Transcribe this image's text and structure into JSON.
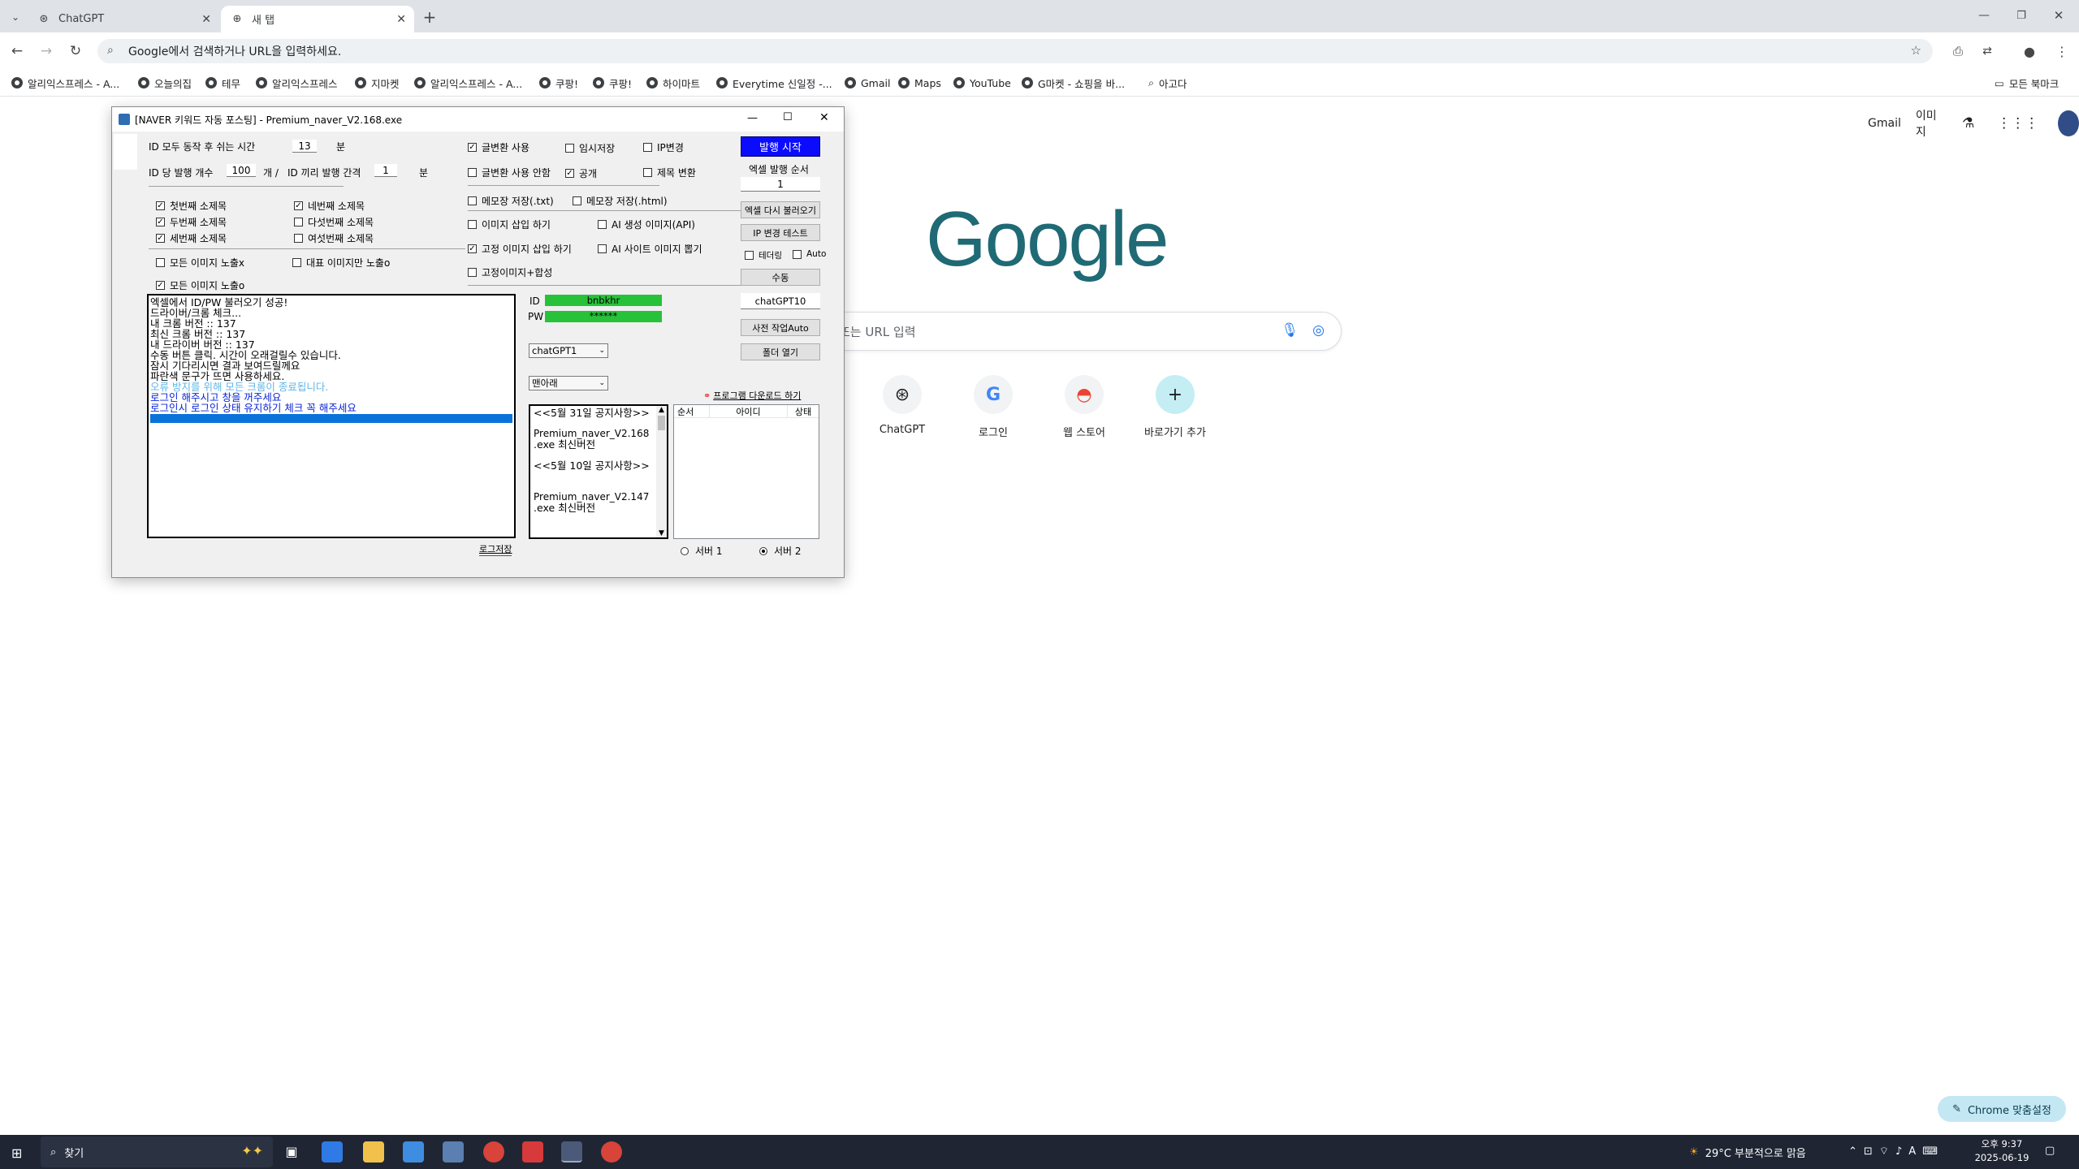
{
  "browser": {
    "tabs": [
      {
        "label": "ChatGPT",
        "active": false
      },
      {
        "label": "새 탭",
        "active": true
      }
    ],
    "omnibox_placeholder": "Google에서 검색하거나 URL을 입력하세요.",
    "bookmarks": [
      "알리익스프레스 - A...",
      "오늘의집",
      "테무",
      "알리익스프레스",
      "지마켓",
      "알리익스프레스 - A...",
      "쿠팡!",
      "쿠팡!",
      "하이마트",
      "Everytime 신일정 -...",
      "Gmail",
      "Maps",
      "YouTube",
      "G마켓 - 쇼핑을 바...",
      "아고다"
    ],
    "all_bookmarks": "모든 북마크"
  },
  "google": {
    "links": [
      "Gmail",
      "이미지"
    ],
    "logo": "Google",
    "search_placeholder": "또는 URL 입력",
    "shortcuts": [
      "ChatGPT",
      "로그인",
      "웹 스토어",
      "바로가기 추가"
    ],
    "customize": "Chrome 맞춤설정"
  },
  "app": {
    "title": "[NAVER 키워드 자동 포스팅] - Premium_naver_V2.168.exe",
    "rest_label": "ID 모두 동작 후 쉬는 시간",
    "rest_value": "13",
    "rest_unit": "분",
    "post_count_label": "ID 당 발행 개수",
    "post_count_value": "100",
    "post_count_unit": "개 /",
    "interval_label": "ID 끼리 발행 간격",
    "interval_value": "1",
    "interval_unit": "분",
    "subtitles": [
      {
        "label": "첫번째 소제목",
        "checked": true
      },
      {
        "label": "네번째 소제목",
        "checked": true
      },
      {
        "label": "두번째 소제목",
        "checked": true
      },
      {
        "label": "다섯번째 소제목",
        "checked": false
      },
      {
        "label": "세번째 소제목",
        "checked": true
      },
      {
        "label": "여섯번째 소제목",
        "checked": false
      }
    ],
    "img_all_hide": "모든 이미지 노출x",
    "img_rep_only": "대표 이미지만 노출o",
    "img_all_show": "모든 이미지 노출o",
    "options": {
      "text_convert": "글변환 사용",
      "temp_save": "임시저장",
      "ip_change": "IP변경",
      "no_text_convert": "글변환 사용 안함",
      "public": "공개",
      "title_convert": "제목 변환",
      "memo_txt": "메모장 저장(.txt)",
      "memo_html": "메모장 저장(.html)",
      "img_insert": "이미지 삽입 하기",
      "ai_img_api": "AI 생성 이미지(API)",
      "fixed_img": "고정 이미지 삽입 하기",
      "ai_site_img": "AI 사이트 이미지 뽑기",
      "fixed_img_combine": "고정이미지+합성"
    },
    "log": [
      {
        "text": "엑셀에서 ID/PW 불러오기 성공!",
        "color": "#000"
      },
      {
        "text": "드라이버/크롬 체크...",
        "color": "#000"
      },
      {
        "text": "내 크롬 버전 :: 137",
        "color": "#000"
      },
      {
        "text": "최신 크롬 버전 :: 137",
        "color": "#000"
      },
      {
        "text": "내 드라이버 버전 :: 137",
        "color": "#000"
      },
      {
        "text": "수동 버튼 클릭. 시간이 오래걸릴수 있습니다.",
        "color": "#000"
      },
      {
        "text": "잠시 기다리시면 결과 보여드릴께요",
        "color": "#000"
      },
      {
        "text": "파란색 문구가 뜨면 사용하세요.",
        "color": "#000"
      },
      {
        "text": "오류 방지를 위해 모든 크롬이 종료됩니다.",
        "color": "#5fb6e8"
      },
      {
        "text": "로그인 해주시고 창을 꺼주세요",
        "color": "#0b24d9"
      },
      {
        "text": "로그인시 로그인 상태 유지하기 체크 꼭 해주세요",
        "color": "#0b24d9"
      }
    ],
    "log_save": "로그저장",
    "id_label": "ID",
    "id_value": "bnbkhr",
    "pw_label": "PW",
    "pw_value": "******",
    "combo1": "chatGPT1",
    "combo2": "맨아래",
    "notices": [
      "<<5월 31일 공지사항>>",
      "",
      "Premium_naver_V2.168",
      ".exe 최신버전",
      "",
      "<<5월 10일 공지사항>>",
      "",
      "",
      "Premium_naver_V2.147",
      ".exe 최신버전"
    ],
    "download_link": "프로그램 다운로드 하기",
    "table_headers": [
      "순서",
      "아이디",
      "상태"
    ],
    "server1": "서버 1",
    "server2": "서버 2",
    "start_btn": "발행 시작",
    "excel_order_label": "엑셀 발행 순서",
    "excel_order_value": "1",
    "reload_excel": "엑셀 다시 불러오기",
    "ip_test": "IP 변경 테스트",
    "tethering": "테더링",
    "auto": "Auto",
    "manual": "수동",
    "chatgpt_field": "chatGPT10",
    "prework": "사전 작업Auto",
    "open_folder": "폴더 열기"
  },
  "taskbar": {
    "search": "찾기",
    "weather": "29°C 부분적으로 맑음",
    "time": "오후 9:37",
    "date": "2025-06-19"
  }
}
